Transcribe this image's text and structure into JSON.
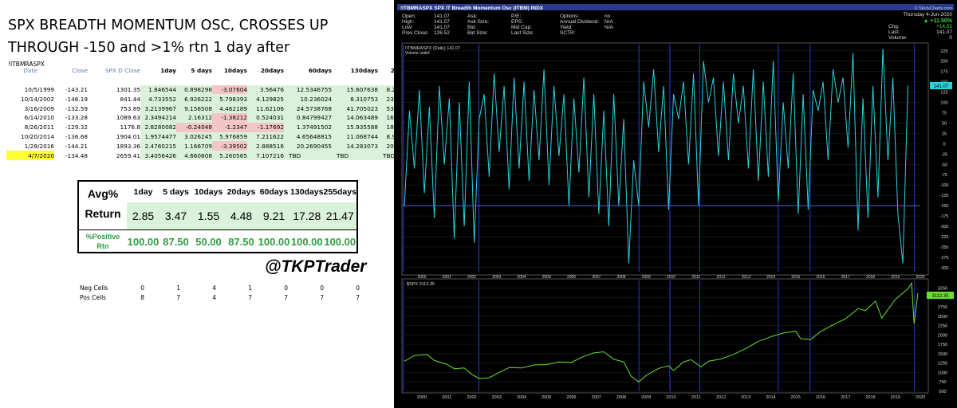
{
  "left": {
    "title_line1": "SPX BREADTH MOMENTUM OSC, CROSSES UP",
    "title_line2": "THROUGH -150 and >1% rtn 1 day after",
    "symbol": "!ITBMRASPX",
    "headers": [
      "Date",
      "Close",
      "SPX D Close",
      "1day",
      "5 days",
      "10days",
      "20days",
      "60days",
      "130days",
      "255days"
    ],
    "rows": [
      {
        "date": "10/5/1999",
        "close": "-143.21",
        "spx": "1301.35",
        "v": [
          "1.846544",
          "0.898298",
          "-3.07604",
          "3.56476",
          "12.5346755",
          "15.607638",
          "8.2714105"
        ],
        "hl": false
      },
      {
        "date": "10/14/2002",
        "close": "-146.19",
        "spx": "841.44",
        "v": [
          "4.733552",
          "6.926222",
          "5.798393",
          "4.129825",
          "10.236024",
          "8.310753",
          "23.516828"
        ],
        "hl": false
      },
      {
        "date": "3/16/2009",
        "close": "-132.59",
        "spx": "753.89",
        "v": [
          "3.2139967",
          "9.156508",
          "4.462189",
          "11.62106",
          "24.5738768",
          "41.705023",
          "53.855337"
        ],
        "hl": false
      },
      {
        "date": "6/14/2010",
        "close": "-133.28",
        "spx": "1089.63",
        "v": [
          "2.3494214",
          "2.16312",
          "-1.38212",
          "0.524031",
          "0.84799427",
          "14.063489",
          "16.336738"
        ],
        "hl": false
      },
      {
        "date": "8/26/2011",
        "close": "-129.32",
        "spx": "1176.8",
        "v": [
          "2.8280082",
          "-0.24048",
          "-1.2347",
          "-1.17692",
          "1.37491502",
          "15.935588",
          "18.922502"
        ],
        "hl": false
      },
      {
        "date": "10/20/2014",
        "close": "-136.68",
        "spx": "1904.01",
        "v": [
          "1.9574477",
          "3.026245",
          "5.976859",
          "7.211622",
          "4.65648815",
          "11.068744",
          "8.9883982"
        ],
        "hl": false
      },
      {
        "date": "1/28/2016",
        "close": "-144.21",
        "spx": "1893.36",
        "v": [
          "2.4760215",
          "1.166709",
          "-3.39502",
          "2.888516",
          "20.2690455",
          "14.283073",
          "20.397072"
        ],
        "hl": false
      },
      {
        "date": "4/7/2020",
        "close": "-134.48",
        "spx": "2659.41",
        "v": [
          "3.4056426",
          "4.660808",
          "5.260565",
          "7.107216",
          "TBD",
          "TBD",
          "TBD"
        ],
        "hl": true
      }
    ],
    "avg_box": {
      "periods": [
        "1day",
        "5 days",
        "10days",
        "20days",
        "60days",
        "130days",
        "255days"
      ],
      "avg_label_1": "Avg%",
      "avg_label_2": "Return",
      "avg_values": [
        "2.85",
        "3.47",
        "1.55",
        "4.48",
        "9.21",
        "17.28",
        "21.47"
      ],
      "pos_label_1": "%Positive",
      "pos_label_2": "Rtn",
      "pos_values": [
        "100.00",
        "87.50",
        "50.00",
        "87.50",
        "100.00",
        "100.00",
        "100.00"
      ]
    },
    "handle": "@TKPTrader",
    "neg_label": "Neg Cells",
    "neg_values": [
      "0",
      "1",
      "4",
      "1",
      "0",
      "0",
      "0"
    ],
    "pos_label": "Pos Cells",
    "pos_values": [
      "8",
      "7",
      "4",
      "7",
      "7",
      "7",
      "7"
    ]
  },
  "chart_data": [
    {
      "type": "line",
      "title": "!ITBMRASPX SPX IT Breadth Momentum Osc (ITBM) INDX",
      "site": "© StockCharts.com",
      "info": {
        "open": "141.07",
        "high": "141.07",
        "low": "141.07",
        "prev_close": "126.52",
        "ask": "",
        "ask_size": "",
        "bid": "",
        "bid_size": "",
        "pe": "",
        "eps": "",
        "mid_cap": "",
        "last_size": "",
        "options": "no",
        "annual_dividend": "N/A",
        "yield": "N/A",
        "sctr": "",
        "date": "Thursday 4-Jun-2020",
        "change_pct": "▲ +11.50%",
        "chg": "+14.55",
        "last": "141.07",
        "volume": "0"
      },
      "legend": "!ITBMRASPX (Daily) 141.07",
      "legend2": "Volume undef",
      "last_badge": "141.07",
      "ylim": [
        -310,
        240
      ],
      "yticks": [
        225,
        200,
        175,
        150,
        125,
        100,
        75,
        50,
        25,
        0,
        -25,
        -50,
        -75,
        -100,
        -125,
        -150,
        -175,
        -200,
        -225,
        -250,
        -275,
        -300
      ],
      "hline": -150,
      "xlim": [
        1999.7,
        2020.5
      ],
      "xticks": [
        "2000",
        "2001",
        "2002",
        "2003",
        "2004",
        "2005",
        "2006",
        "2007",
        "2008",
        "2009",
        "2010",
        "2011",
        "2012",
        "2013",
        "2014",
        "2015",
        "2016",
        "2017",
        "2018",
        "2019",
        "2020"
      ],
      "signal_dates": [
        1999.76,
        2002.79,
        2009.21,
        2010.45,
        2011.65,
        2014.8,
        2016.08,
        2020.27
      ],
      "x": [
        1999.8,
        2000.0,
        2000.2,
        2000.4,
        2000.6,
        2000.8,
        2001.0,
        2001.2,
        2001.4,
        2001.6,
        2001.8,
        2002.0,
        2002.2,
        2002.4,
        2002.6,
        2002.8,
        2003.0,
        2003.2,
        2003.4,
        2003.6,
        2003.8,
        2004.0,
        2004.2,
        2004.4,
        2004.6,
        2004.8,
        2005.0,
        2005.2,
        2005.4,
        2005.6,
        2005.8,
        2006.0,
        2006.2,
        2006.4,
        2006.6,
        2006.8,
        2007.0,
        2007.2,
        2007.4,
        2007.6,
        2007.8,
        2008.0,
        2008.2,
        2008.4,
        2008.6,
        2008.8,
        2009.0,
        2009.2,
        2009.4,
        2009.6,
        2009.8,
        2010.0,
        2010.2,
        2010.4,
        2010.6,
        2010.8,
        2011.0,
        2011.2,
        2011.4,
        2011.6,
        2011.8,
        2012.0,
        2012.2,
        2012.4,
        2012.6,
        2012.8,
        2013.0,
        2013.2,
        2013.4,
        2013.6,
        2013.8,
        2014.0,
        2014.2,
        2014.4,
        2014.6,
        2014.8,
        2015.0,
        2015.2,
        2015.4,
        2015.6,
        2015.8,
        2016.0,
        2016.2,
        2016.4,
        2016.6,
        2016.8,
        2017.0,
        2017.2,
        2017.4,
        2017.6,
        2017.8,
        2018.0,
        2018.2,
        2018.4,
        2018.6,
        2018.8,
        2019.0,
        2019.2,
        2019.4,
        2019.6,
        2019.8,
        2020.0,
        2020.2,
        2020.4
      ],
      "y": [
        -150,
        80,
        -60,
        130,
        -120,
        90,
        -180,
        140,
        -50,
        110,
        -230,
        100,
        -200,
        150,
        -240,
        60,
        120,
        -80,
        170,
        -20,
        140,
        -110,
        160,
        -60,
        150,
        -90,
        130,
        -40,
        180,
        -100,
        140,
        -30,
        120,
        -150,
        110,
        -70,
        160,
        -130,
        120,
        -170,
        80,
        -200,
        120,
        -150,
        60,
        -290,
        -40,
        -150,
        150,
        40,
        180,
        -20,
        140,
        -160,
        120,
        60,
        150,
        -50,
        170,
        -150,
        200,
        100,
        160,
        -30,
        150,
        -40,
        170,
        50,
        140,
        -60,
        180,
        -90,
        150,
        -80,
        200,
        -140,
        100,
        -60,
        170,
        -170,
        120,
        -160,
        130,
        80,
        150,
        -40,
        180,
        100,
        160,
        -10,
        220,
        -210,
        110,
        -180,
        140,
        -130,
        230,
        -40,
        160,
        -170,
        -290,
        141.07
      ]
    },
    {
      "type": "line",
      "title": "$SPX 3112.35",
      "last_badge": "3112.35",
      "ylim": [
        500,
        3450
      ],
      "yticks": [
        3250,
        3000,
        2750,
        2500,
        2250,
        2000,
        1750,
        1500,
        1250,
        1000,
        750,
        500
      ],
      "xlim": [
        1999.7,
        2020.5
      ],
      "x": [
        1999.8,
        2000.2,
        2000.7,
        2001.0,
        2001.5,
        2001.8,
        2002.2,
        2002.5,
        2002.8,
        2003.2,
        2003.6,
        2004.0,
        2004.5,
        2005.0,
        2005.5,
        2006.0,
        2006.5,
        2007.0,
        2007.4,
        2007.8,
        2008.2,
        2008.6,
        2008.9,
        2009.2,
        2009.5,
        2010.0,
        2010.4,
        2010.6,
        2011.0,
        2011.3,
        2011.7,
        2012.0,
        2012.5,
        2013.0,
        2013.5,
        2014.0,
        2014.5,
        2015.0,
        2015.5,
        2015.7,
        2016.1,
        2016.5,
        2017.0,
        2017.5,
        2018.0,
        2018.3,
        2018.7,
        2018.95,
        2019.5,
        2020.0,
        2020.15,
        2020.25,
        2020.4
      ],
      "y": [
        1300,
        1450,
        1480,
        1320,
        1220,
        1100,
        1120,
        950,
        840,
        860,
        1000,
        1130,
        1120,
        1200,
        1210,
        1280,
        1270,
        1430,
        1520,
        1550,
        1350,
        1280,
        900,
        750,
        920,
        1110,
        1180,
        1050,
        1280,
        1340,
        1150,
        1300,
        1360,
        1480,
        1640,
        1830,
        1950,
        2050,
        2100,
        1900,
        1880,
        2090,
        2270,
        2430,
        2700,
        2650,
        2900,
        2450,
        2950,
        3230,
        3380,
        2300,
        3112.35
      ]
    }
  ]
}
